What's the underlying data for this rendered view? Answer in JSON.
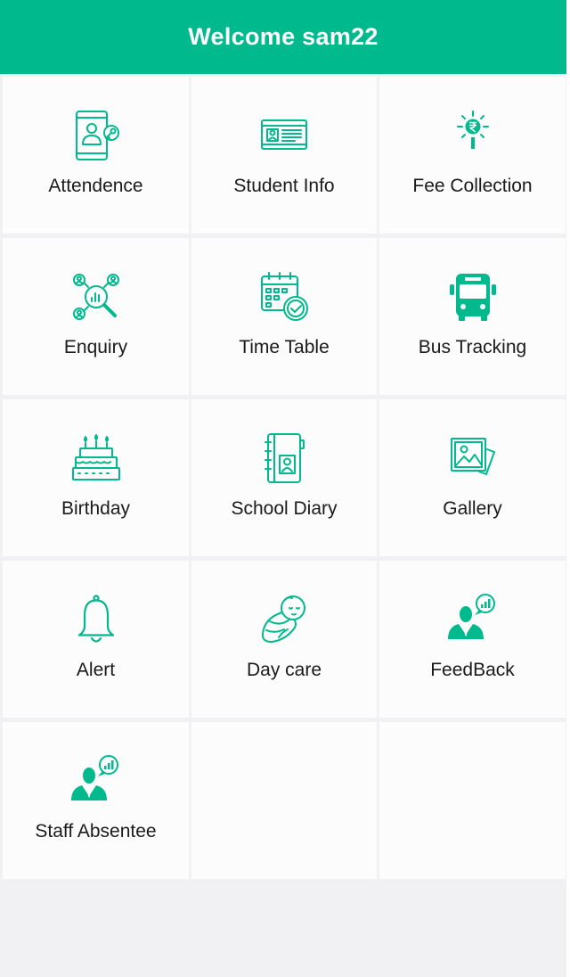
{
  "header": {
    "title": "Welcome sam22"
  },
  "theme": {
    "accent": "#00b98d",
    "text": "#1a1a1a",
    "tile_bg": "#fcfcfd",
    "page_bg": "#f1f1f3"
  },
  "menu": [
    {
      "label": "Attendence",
      "icon": "tablet-key-icon"
    },
    {
      "label": "Student Info",
      "icon": "id-card-icon"
    },
    {
      "label": "Fee Collection",
      "icon": "rupee-bulb-icon"
    },
    {
      "label": "Enquiry",
      "icon": "people-search-icon"
    },
    {
      "label": "Time Table",
      "icon": "calendar-clock-icon"
    },
    {
      "label": "Bus Tracking",
      "icon": "bus-icon"
    },
    {
      "label": "Birthday",
      "icon": "birthday-cake-icon"
    },
    {
      "label": "School Diary",
      "icon": "diary-icon"
    },
    {
      "label": "Gallery",
      "icon": "gallery-icon"
    },
    {
      "label": "Alert",
      "icon": "bell-icon"
    },
    {
      "label": "Day care",
      "icon": "baby-icon"
    },
    {
      "label": "FeedBack",
      "icon": "person-chart-bubble-icon"
    },
    {
      "label": "Staff Absentee",
      "icon": "person-chart-bubble-icon"
    }
  ]
}
